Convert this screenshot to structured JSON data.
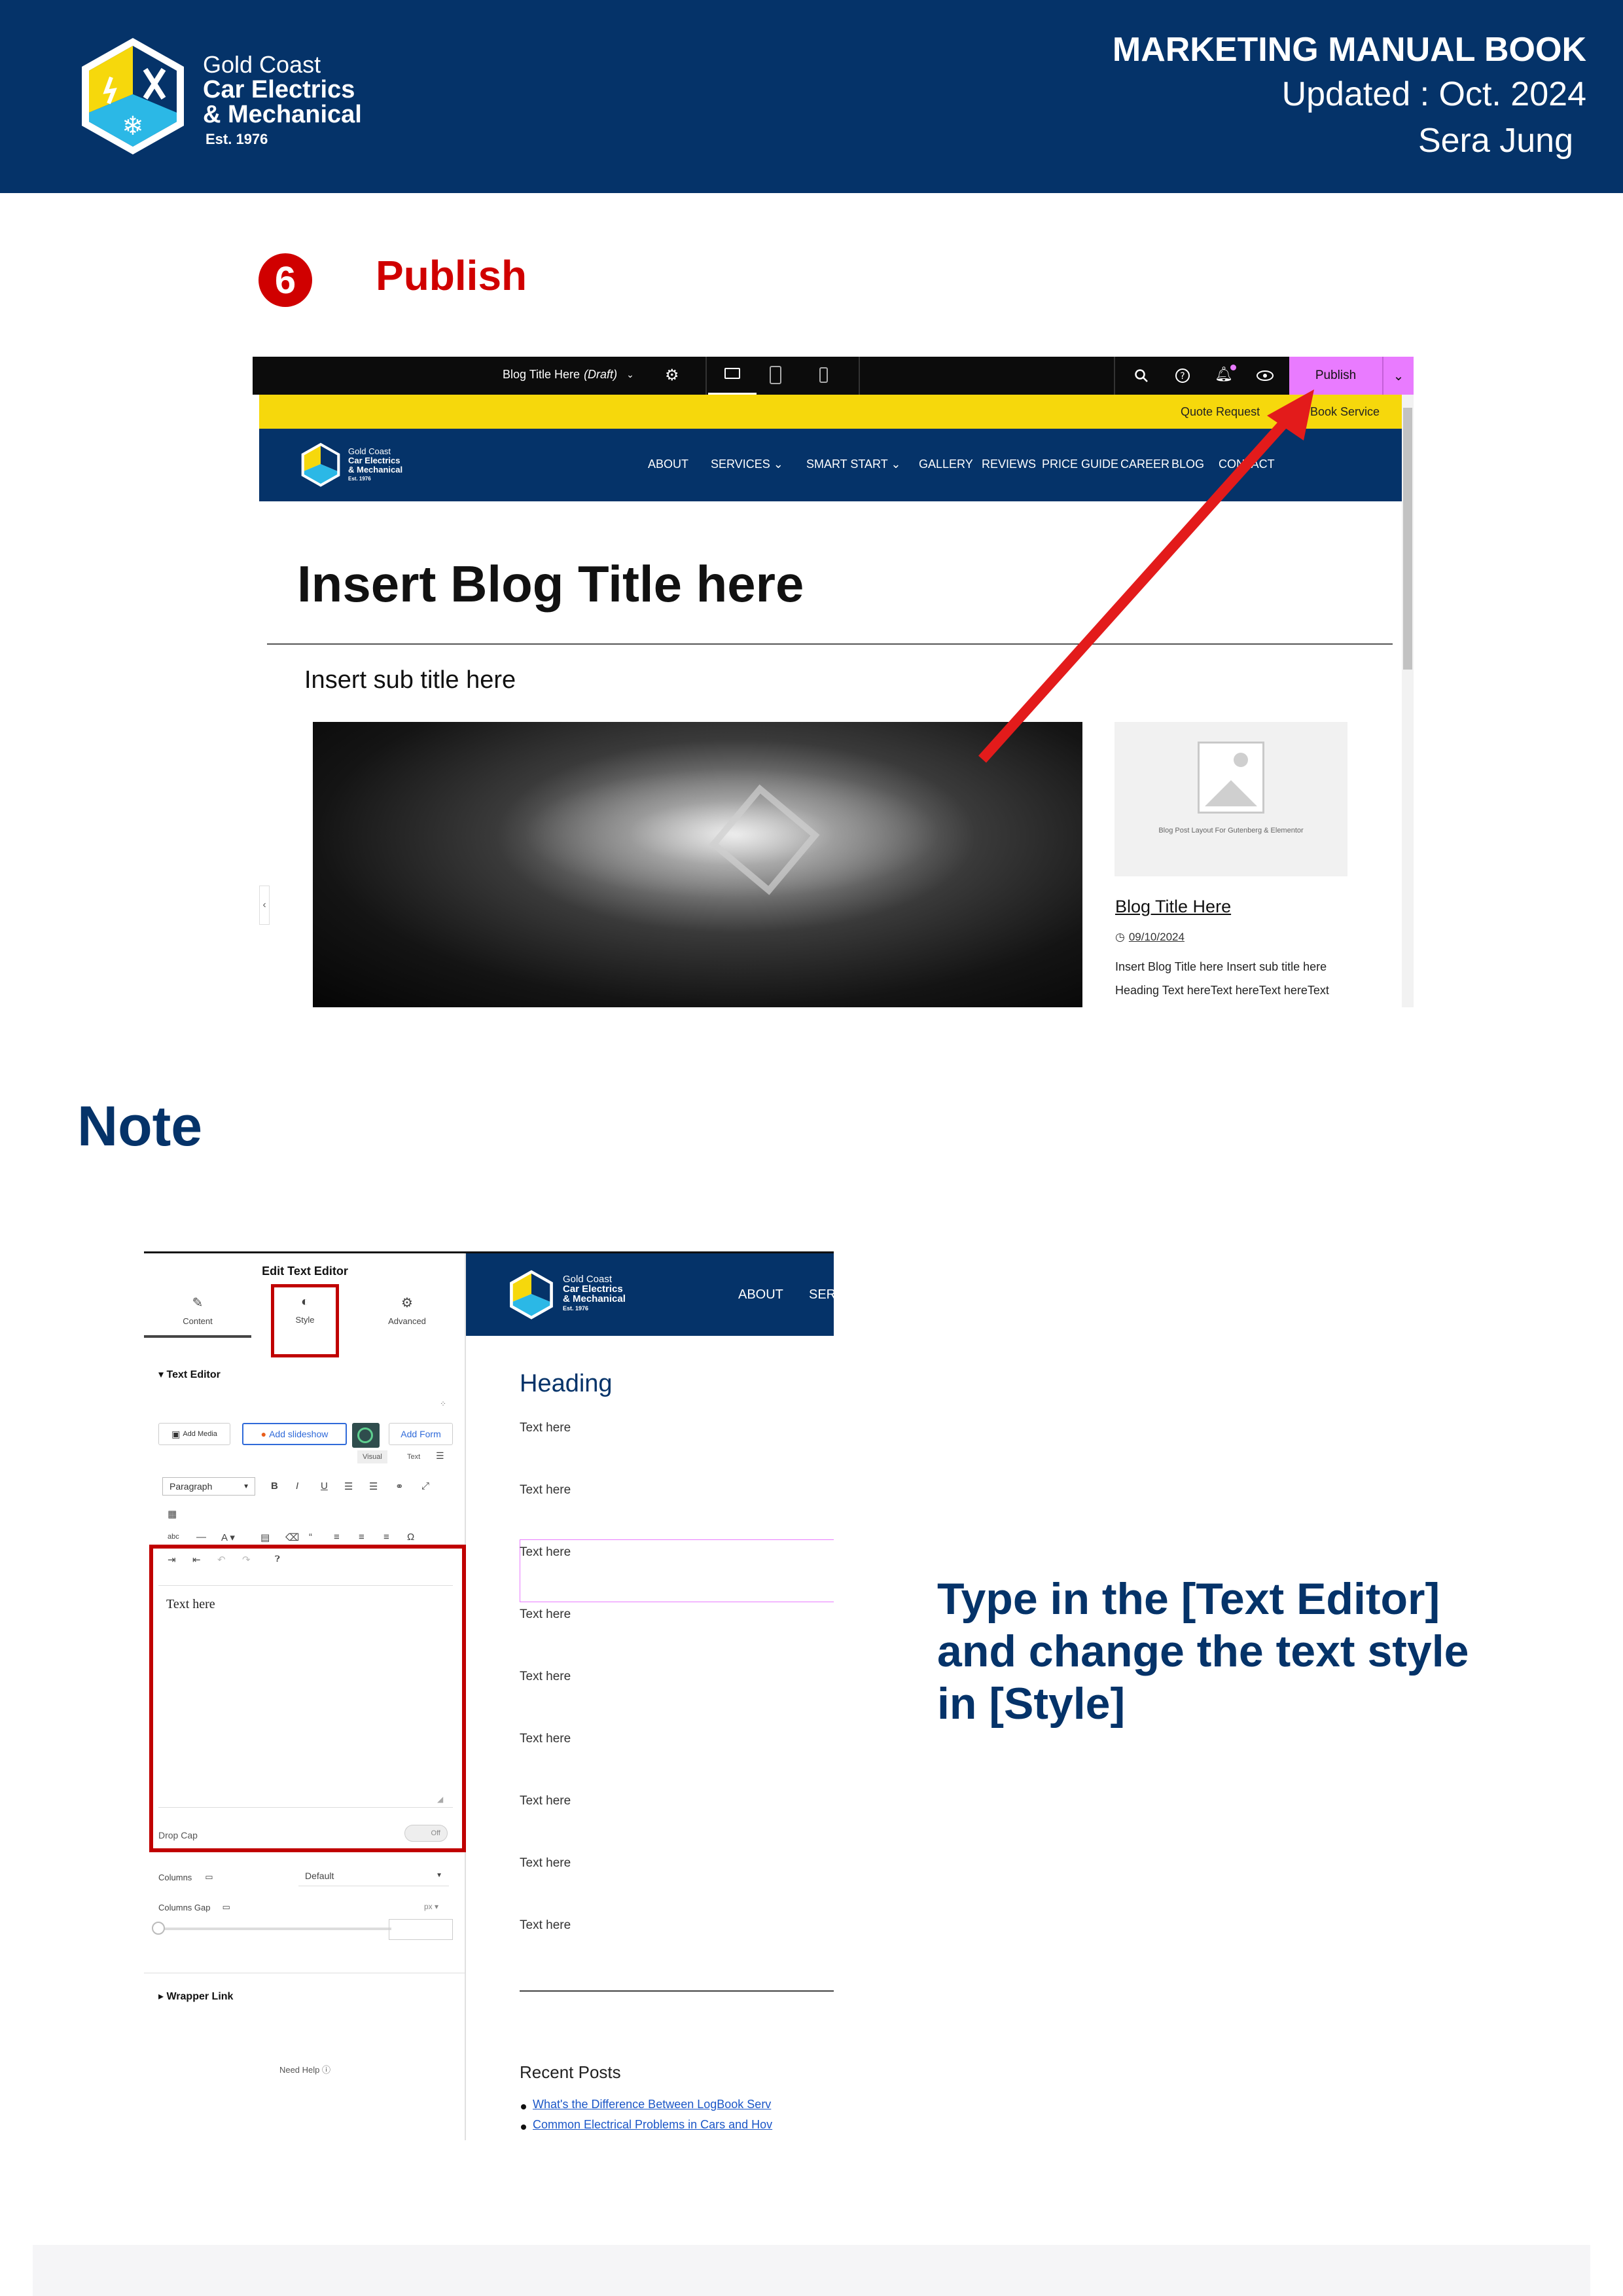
{
  "header": {
    "company_line1": "Gold Coast",
    "company_line2": "Car Electrics",
    "company_line3": "& Mechanical",
    "company_est": "Est. 1976",
    "manual_title": "MARKETING MANUAL BOOK",
    "updated": "Updated : Oct. 2024",
    "author": "Sera Jung",
    "colors": {
      "band": "#053369",
      "logo_yellow": "#f6d80c",
      "logo_cyan": "#2bb8e6"
    }
  },
  "step": {
    "number": "6",
    "title": "Publish",
    "color": "#d00000"
  },
  "screenshot1": {
    "draft_title": "Blog Title Here",
    "draft_status": "(Draft)",
    "publish_label": "Publish",
    "quote_request": "Quote Request",
    "book_service": "Book Service",
    "nav": [
      "ABOUT",
      "SERVICES",
      "SMART START",
      "GALLERY",
      "REVIEWS",
      "PRICE GUIDE",
      "CAREER",
      "BLOG",
      "CONTACT"
    ],
    "blog_title": "Insert Blog Title here",
    "sub_title": "Insert sub title here",
    "card_caption": "Blog Post Layout For Gutenberg & Elementor",
    "card_title": "Blog Title Here",
    "card_date": "09/10/2024",
    "card_desc1": "Insert Blog Title here Insert sub title here",
    "card_desc2": "Heading Text hereText hereText hereText",
    "icons": [
      "settings-icon",
      "desktop-icon",
      "tablet-icon",
      "mobile-icon",
      "search-icon",
      "help-icon",
      "notification-icon",
      "preview-eye-icon",
      "chevron-down-icon",
      "arrow-icon"
    ]
  },
  "note": {
    "title": "Note",
    "line1": "Type in the [Text Editor]",
    "line2": "and change the text style",
    "line3": "in [Style]"
  },
  "screenshot2": {
    "panel_title": "Edit Text Editor",
    "tab_content": "Content",
    "tab_style": "Style",
    "tab_advanced": "Advanced",
    "section_text_editor": "Text Editor",
    "add_media": "Add Media",
    "add_slideshow": "Add slideshow",
    "add_form": "Add Form",
    "mode_visual": "Visual",
    "mode_text": "Text",
    "format": "Paragraph",
    "editor_text": "Text here",
    "drop_cap": "Drop Cap",
    "drop_cap_state": "Off",
    "columns": "Columns",
    "columns_value": "Default",
    "columns_gap": "Columns Gap",
    "columns_gap_unit": "px",
    "wrapper_link": "Wrapper Link",
    "need_help": "Need Help",
    "site_company_line1": "Gold Coast",
    "site_company_line2": "Car Electrics",
    "site_company_line3": "& Mechanical",
    "site_est": "Est. 1976",
    "site_nav_about": "ABOUT",
    "site_nav_cut": "SER",
    "heading": "Heading",
    "text_items": [
      "Text here",
      "Text here",
      "Text here",
      "Text here",
      "Text here",
      "Text here",
      "Text here",
      "Text here",
      "Text here"
    ],
    "recent_posts_title": "Recent Posts",
    "recent_posts": [
      "What's the Difference Between LogBook Serv",
      "Common Electrical Problems in Cars and Hov"
    ]
  }
}
